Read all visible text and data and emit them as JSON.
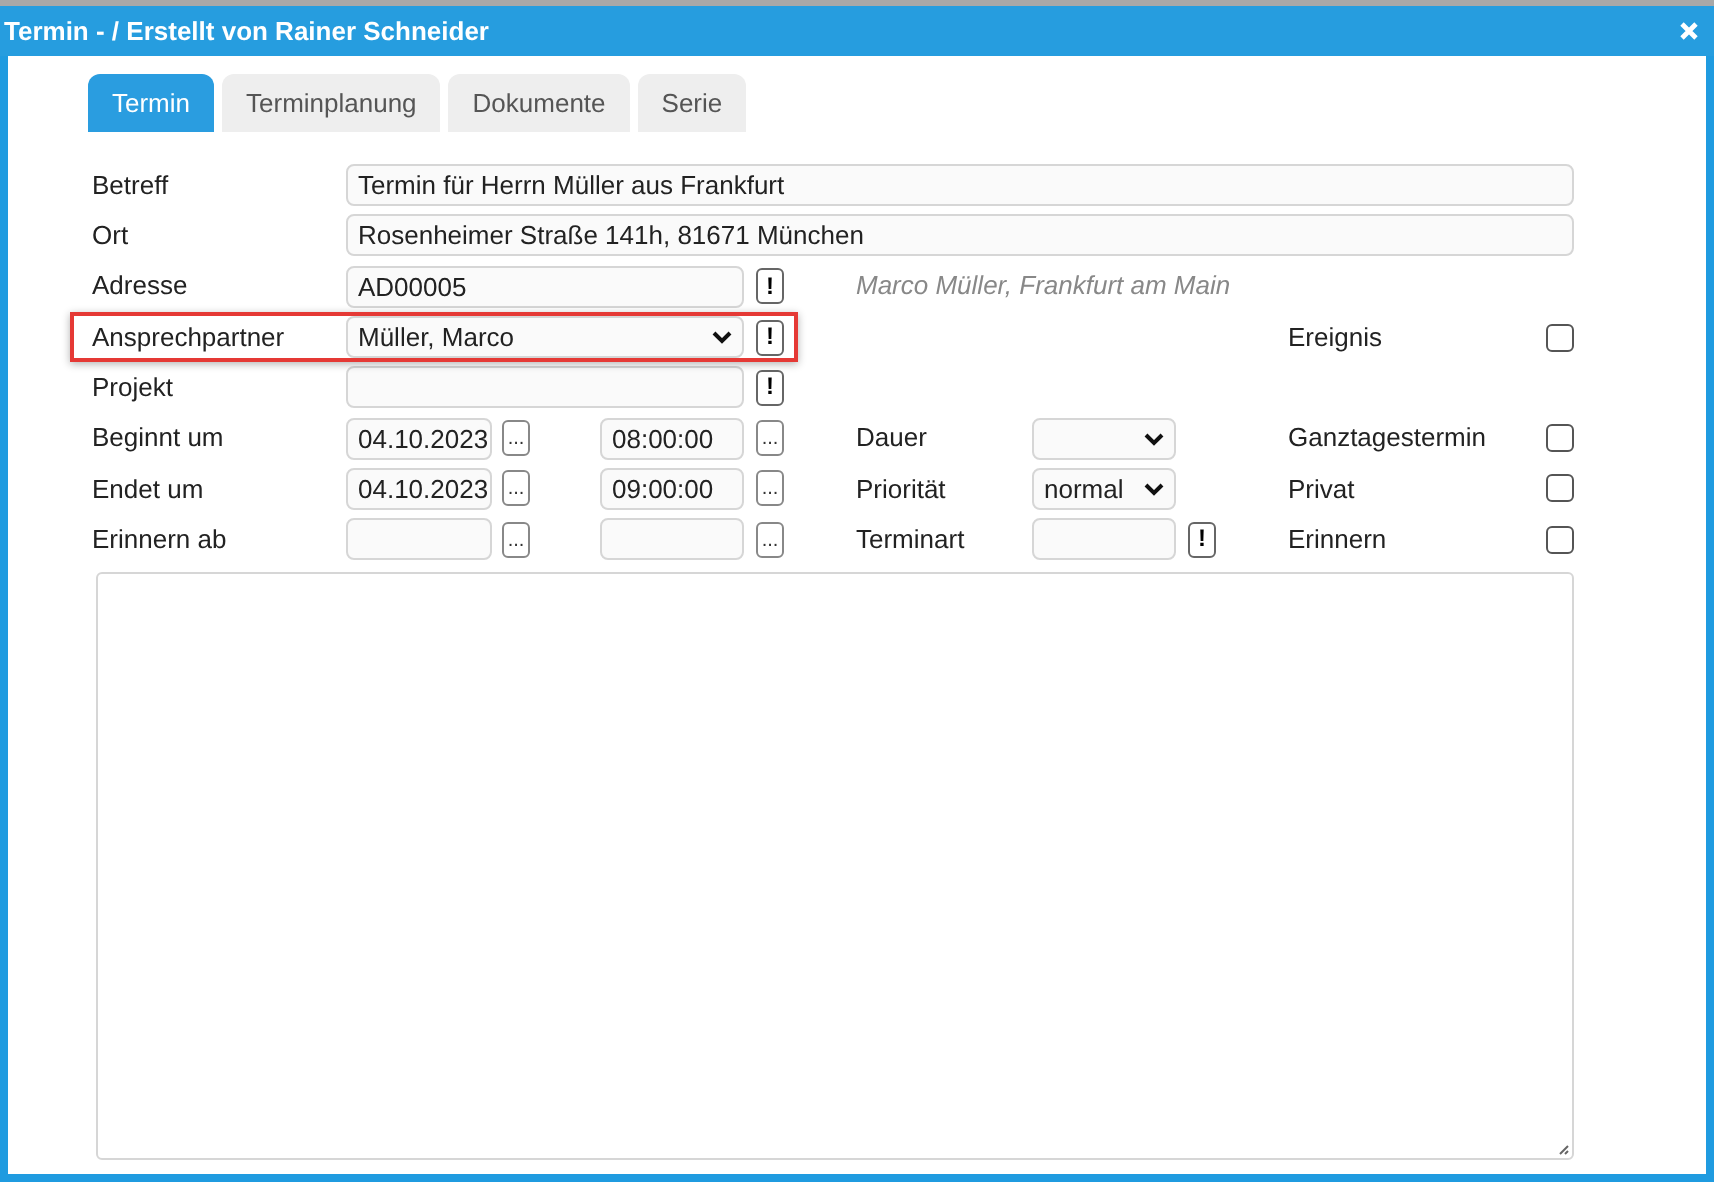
{
  "window": {
    "title": "Termin - / Erstellt von Rainer Schneider"
  },
  "tabs": [
    {
      "label": "Termin",
      "selected": true
    },
    {
      "label": "Terminplanung",
      "selected": false
    },
    {
      "label": "Dokumente",
      "selected": false
    },
    {
      "label": "Serie",
      "selected": false
    }
  ],
  "subject": {
    "label": "Betreff",
    "value": "Termin für Herrn Müller aus Frankfurt"
  },
  "location": {
    "label": "Ort",
    "value": "Rosenheimer Straße 141h, 81671 München"
  },
  "address": {
    "label": "Adresse",
    "value": "AD00005",
    "button": "!",
    "note": "Marco Müller, Frankfurt am Main"
  },
  "contact": {
    "label": "Ansprechpartner",
    "value": "Müller, Marco",
    "button": "!",
    "highlighted": true
  },
  "project": {
    "label": "Projekt",
    "button": "!"
  },
  "start": {
    "label": "Beginnt um",
    "date": "04.10.2023",
    "date_button": "...",
    "time": "08:00:00",
    "time_button": "..."
  },
  "end": {
    "label": "Endet um",
    "date": "04.10.2023",
    "date_button": "...",
    "time": "09:00:00",
    "time_button": "..."
  },
  "reminder_from": {
    "label": "Erinnern ab",
    "date_button": "...",
    "time_button": "..."
  },
  "duration": {
    "label": "Dauer"
  },
  "priority": {
    "label": "Priorität",
    "value": "normal"
  },
  "appointment_type": {
    "label": "Terminart",
    "button": "!"
  },
  "flags": [
    {
      "label": "Ereignis",
      "checked": false
    },
    {
      "label": "Ganztagestermin",
      "checked": false
    },
    {
      "label": "Privat",
      "checked": false
    },
    {
      "label": "Erinnern",
      "checked": false
    }
  ]
}
